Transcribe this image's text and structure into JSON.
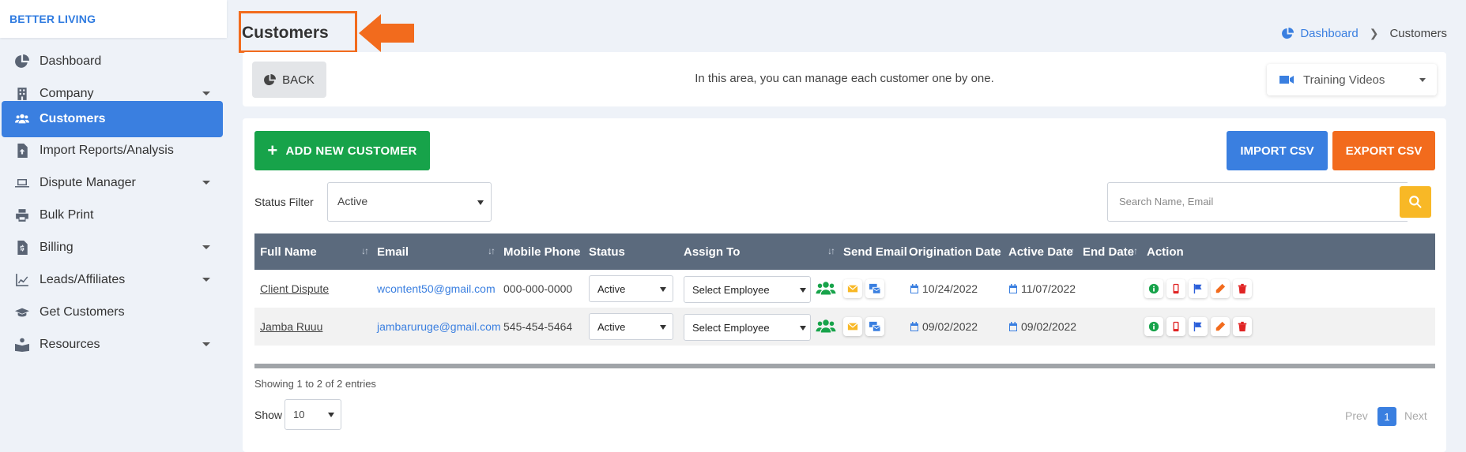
{
  "brand": "BETTER LIVING",
  "sidebar": {
    "items": [
      {
        "label": "Dashboard"
      },
      {
        "label": "Company"
      },
      {
        "label": "Customers"
      },
      {
        "label": "Import Reports/Analysis"
      },
      {
        "label": "Dispute Manager"
      },
      {
        "label": "Bulk Print"
      },
      {
        "label": "Billing"
      },
      {
        "label": "Leads/Affiliates"
      },
      {
        "label": "Get Customers"
      },
      {
        "label": "Resources"
      }
    ]
  },
  "header": {
    "title": "Customers",
    "breadcrumb": {
      "home": "Dashboard",
      "current": "Customers"
    }
  },
  "info_bar": {
    "back_label": "BACK",
    "text": "In this area, you can manage each customer one by one.",
    "training_label": "Training Videos"
  },
  "toolbar": {
    "add_label": "ADD NEW CUSTOMER",
    "import_label": "IMPORT CSV",
    "export_label": "EXPORT CSV",
    "status_filter_label": "Status Filter",
    "status_filter_value": "Active",
    "search_placeholder": "Search Name, Email"
  },
  "table": {
    "columns": [
      "Full Name",
      "Email",
      "Mobile Phone",
      "Status",
      "Assign To",
      "Send Email",
      "Origination Date",
      "Active Date",
      "End Date",
      "Action"
    ],
    "rows": [
      {
        "name": "Client Dispute",
        "email": "wcontent50@gmail.com",
        "phone": "000-000-0000",
        "status": "Active",
        "assign": "Select Employee",
        "origination": "10/24/2022",
        "active": "11/07/2022",
        "end": ""
      },
      {
        "name": "Jamba Ruuu",
        "email": "jambaruruge@gmail.com",
        "phone": "545-454-5464",
        "status": "Active",
        "assign": "Select Employee",
        "origination": "09/02/2022",
        "active": "09/02/2022",
        "end": ""
      }
    ]
  },
  "footer": {
    "showing": "Showing 1 to 2 of 2 entries",
    "show_label": "Show",
    "show_value": "10",
    "prev": "Prev",
    "page": "1",
    "next": "Next"
  },
  "colors": {
    "primary": "#3a7fe0",
    "success": "#17a34a",
    "orange": "#f26b1d",
    "yellow": "#f8b826",
    "table_header": "#5b6a7d"
  }
}
